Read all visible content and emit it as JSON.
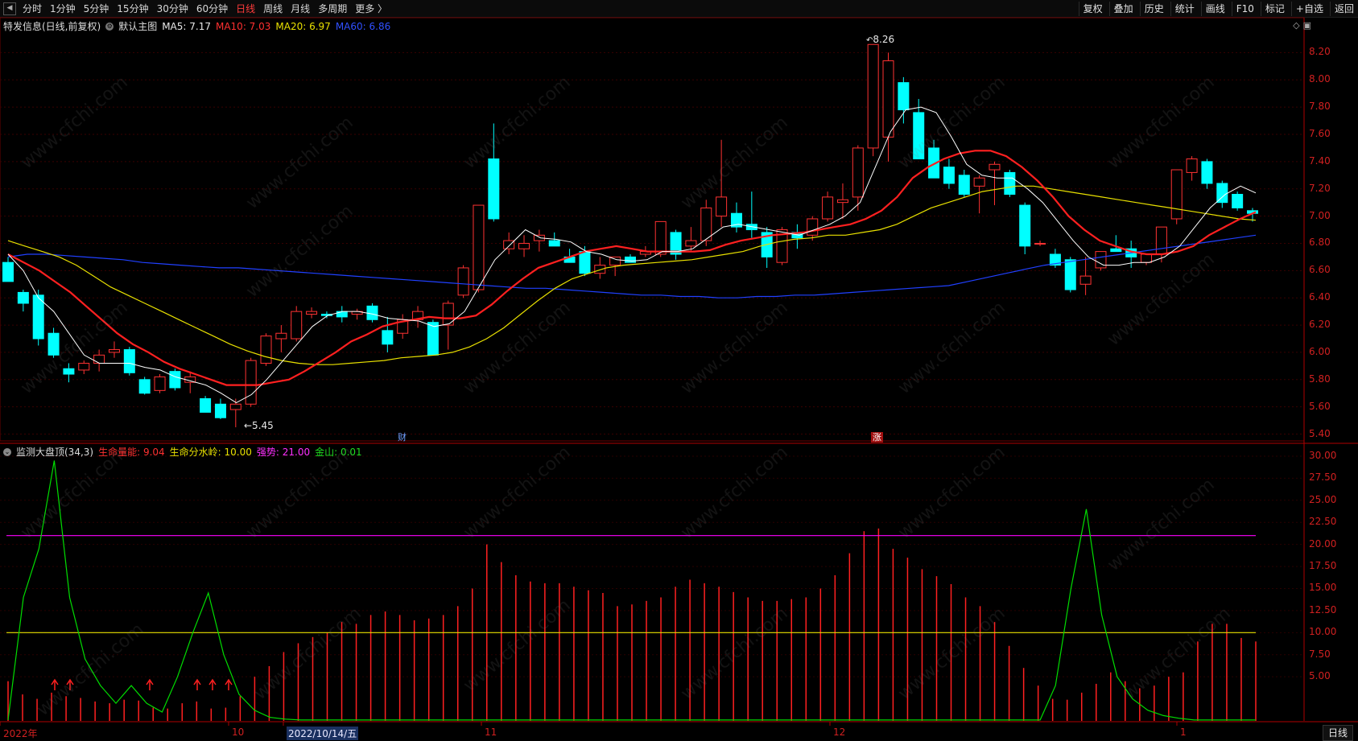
{
  "toolbar": {
    "periods": [
      "分时",
      "1分钟",
      "5分钟",
      "15分钟",
      "30分钟",
      "60分钟",
      "日线",
      "周线",
      "月线",
      "多周期",
      "更多 〉"
    ],
    "active_period": "日线",
    "right_buttons": [
      "复权",
      "叠加",
      "历史",
      "统计",
      "画线",
      "F10",
      "标记",
      "+自选",
      "返回"
    ]
  },
  "main_legend": {
    "stock": "特发信息(日线,前复权)",
    "template": "默认主图",
    "ma5": "MA5: 7.17",
    "ma10": "MA10: 7.03",
    "ma20": "MA20: 6.97",
    "ma60": "MA60: 6.86"
  },
  "sub_legend": {
    "indicator": "监测大盘顶(34,3)",
    "life_energy": "生命量能: 9.04",
    "life_watershed": "生命分水岭: 10.00",
    "strong": "强势: 21.00",
    "gold": "金山: 0.01"
  },
  "price_axis": [
    "8.20",
    "8.00",
    "7.80",
    "7.60",
    "7.40",
    "7.20",
    "7.00",
    "6.80",
    "6.60",
    "6.40",
    "6.20",
    "6.00",
    "5.80",
    "5.60",
    "5.40"
  ],
  "sub_axis": [
    "30.00",
    "27.50",
    "25.00",
    "22.50",
    "20.00",
    "17.50",
    "15.00",
    "12.50",
    "10.00",
    "7.50",
    "5.00"
  ],
  "x_axis": [
    "2022年",
    "10",
    "2022/10/14/五",
    "11",
    "12",
    "1"
  ],
  "annotations": {
    "high": "8.26",
    "low": "←5.45",
    "high_arrow": "↶"
  },
  "markers": {
    "finance": "财",
    "limit_up": "涨"
  },
  "period_button": "日线",
  "watermark": "www.cfchi.com",
  "colors": {
    "up": "#ff3232",
    "down": "#00ffff",
    "ma5": "#ffffff",
    "ma10": "#ff2020",
    "ma20": "#e8e000",
    "ma60": "#2040ff",
    "energy": "#ff2020",
    "green": "#00dd00",
    "magenta": "#ff00ff",
    "yellow": "#e8e000",
    "axis": "#d02020"
  },
  "chart_data": {
    "type": "candlestick",
    "title": "特发信息(日线,前复权)",
    "price_range": [
      5.35,
      8.35
    ],
    "candles": [
      [
        6.66,
        6.7,
        6.52,
        6.52
      ],
      [
        6.44,
        6.46,
        6.3,
        6.36
      ],
      [
        6.42,
        6.46,
        6.05,
        6.1
      ],
      [
        6.14,
        6.18,
        5.96,
        5.98
      ],
      [
        5.88,
        5.92,
        5.78,
        5.84
      ],
      [
        5.87,
        5.94,
        5.84,
        5.92
      ],
      [
        5.92,
        6.02,
        5.86,
        5.98
      ],
      [
        6.0,
        6.08,
        5.96,
        6.02
      ],
      [
        6.02,
        6.04,
        5.83,
        5.85
      ],
      [
        5.8,
        5.82,
        5.69,
        5.7
      ],
      [
        5.72,
        5.84,
        5.7,
        5.82
      ],
      [
        5.86,
        5.88,
        5.72,
        5.74
      ],
      [
        5.78,
        5.86,
        5.7,
        5.82
      ],
      [
        5.66,
        5.68,
        5.56,
        5.56
      ],
      [
        5.62,
        5.66,
        5.51,
        5.52
      ],
      [
        5.58,
        5.66,
        5.45,
        5.62
      ],
      [
        5.62,
        5.96,
        5.6,
        5.94
      ],
      [
        5.92,
        6.14,
        5.9,
        6.12
      ],
      [
        6.1,
        6.2,
        6.0,
        6.14
      ],
      [
        6.1,
        6.34,
        6.08,
        6.3
      ],
      [
        6.28,
        6.33,
        6.25,
        6.3
      ],
      [
        6.28,
        6.3,
        6.25,
        6.27
      ],
      [
        6.3,
        6.34,
        6.22,
        6.26
      ],
      [
        6.28,
        6.32,
        6.24,
        6.3
      ],
      [
        6.34,
        6.36,
        6.22,
        6.24
      ],
      [
        6.16,
        6.26,
        6.0,
        6.06
      ],
      [
        6.14,
        6.28,
        6.1,
        6.24
      ],
      [
        6.24,
        6.34,
        6.18,
        6.3
      ],
      [
        6.22,
        6.24,
        5.98,
        5.98
      ],
      [
        6.2,
        6.38,
        6.02,
        6.36
      ],
      [
        6.42,
        6.64,
        6.4,
        6.62
      ],
      [
        6.46,
        7.08,
        6.44,
        7.08
      ],
      [
        7.42,
        7.68,
        6.96,
        6.98
      ],
      [
        6.76,
        6.88,
        6.72,
        6.82
      ],
      [
        6.76,
        6.86,
        6.7,
        6.8
      ],
      [
        6.82,
        6.9,
        6.74,
        6.86
      ],
      [
        6.82,
        6.88,
        6.78,
        6.78
      ],
      [
        6.7,
        6.76,
        6.68,
        6.66
      ],
      [
        6.74,
        6.78,
        6.56,
        6.58
      ],
      [
        6.58,
        6.7,
        6.54,
        6.64
      ],
      [
        6.64,
        6.7,
        6.56,
        6.7
      ],
      [
        6.7,
        6.72,
        6.66,
        6.66
      ],
      [
        6.72,
        6.78,
        6.7,
        6.74
      ],
      [
        6.72,
        6.96,
        6.7,
        6.96
      ],
      [
        6.88,
        6.9,
        6.68,
        6.72
      ],
      [
        6.78,
        6.92,
        6.74,
        6.82
      ],
      [
        6.82,
        7.12,
        6.78,
        7.06
      ],
      [
        7.0,
        7.56,
        6.92,
        7.14
      ],
      [
        7.02,
        7.1,
        6.88,
        6.92
      ],
      [
        6.94,
        7.18,
        6.84,
        6.9
      ],
      [
        6.88,
        6.92,
        6.62,
        6.7
      ],
      [
        6.66,
        6.92,
        6.64,
        6.9
      ],
      [
        6.88,
        6.94,
        6.76,
        6.84
      ],
      [
        6.86,
        7.0,
        6.82,
        6.98
      ],
      [
        6.98,
        7.18,
        6.96,
        7.14
      ],
      [
        7.1,
        7.24,
        6.98,
        7.12
      ],
      [
        7.14,
        7.52,
        7.04,
        7.5
      ],
      [
        7.5,
        8.26,
        7.44,
        8.26
      ],
      [
        7.58,
        8.2,
        7.4,
        8.14
      ],
      [
        7.98,
        8.02,
        7.68,
        7.78
      ],
      [
        7.76,
        7.86,
        7.42,
        7.42
      ],
      [
        7.5,
        7.56,
        7.28,
        7.28
      ],
      [
        7.36,
        7.42,
        7.2,
        7.24
      ],
      [
        7.3,
        7.34,
        7.14,
        7.16
      ],
      [
        7.22,
        7.3,
        7.02,
        7.28
      ],
      [
        7.34,
        7.4,
        7.08,
        7.38
      ],
      [
        7.32,
        7.34,
        7.14,
        7.16
      ],
      [
        7.08,
        7.1,
        6.72,
        6.78
      ],
      [
        6.8,
        6.82,
        6.78,
        6.8
      ],
      [
        6.72,
        6.76,
        6.62,
        6.64
      ],
      [
        6.68,
        6.7,
        6.44,
        6.46
      ],
      [
        6.5,
        6.7,
        6.42,
        6.56
      ],
      [
        6.62,
        6.72,
        6.6,
        6.74
      ],
      [
        6.76,
        6.86,
        6.74,
        6.74
      ],
      [
        6.76,
        6.82,
        6.62,
        6.7
      ],
      [
        6.66,
        6.7,
        6.64,
        6.72
      ],
      [
        6.72,
        6.8,
        6.66,
        6.92
      ],
      [
        6.98,
        7.34,
        6.94,
        7.34
      ],
      [
        7.32,
        7.44,
        7.26,
        7.42
      ],
      [
        7.4,
        7.42,
        7.2,
        7.24
      ],
      [
        7.24,
        7.26,
        7.06,
        7.1
      ],
      [
        7.16,
        7.18,
        7.04,
        7.06
      ],
      [
        7.04,
        7.06,
        6.96,
        7.02
      ]
    ],
    "ma5": [
      6.72,
      6.6,
      6.4,
      6.3,
      6.14,
      5.98,
      5.92,
      5.92,
      5.92,
      5.89,
      5.87,
      5.82,
      5.79,
      5.76,
      5.7,
      5.63,
      5.69,
      5.8,
      5.93,
      6.06,
      6.19,
      6.27,
      6.3,
      6.3,
      6.28,
      6.25,
      6.24,
      6.23,
      6.19,
      6.21,
      6.3,
      6.49,
      6.68,
      6.79,
      6.9,
      6.84,
      6.83,
      6.81,
      6.74,
      6.72,
      6.68,
      6.67,
      6.68,
      6.74,
      6.74,
      6.76,
      6.84,
      6.92,
      6.94,
      6.92,
      6.9,
      6.88,
      6.86,
      6.9,
      6.94,
      7.0,
      7.1,
      7.36,
      7.62,
      7.78,
      7.8,
      7.76,
      7.58,
      7.38,
      7.3,
      7.28,
      7.28,
      7.2,
      7.1,
      6.96,
      6.82,
      6.7,
      6.64,
      6.64,
      6.66,
      6.66,
      6.7,
      6.78,
      6.92,
      7.06,
      7.16,
      7.22,
      7.17
    ],
    "ma10": [
      6.72,
      6.66,
      6.6,
      6.52,
      6.44,
      6.34,
      6.24,
      6.14,
      6.06,
      6.0,
      5.93,
      5.88,
      5.84,
      5.8,
      5.76,
      5.76,
      5.76,
      5.78,
      5.8,
      5.86,
      5.93,
      6.0,
      6.08,
      6.13,
      6.19,
      6.22,
      6.24,
      6.26,
      6.25,
      6.25,
      6.27,
      6.35,
      6.45,
      6.54,
      6.62,
      6.66,
      6.7,
      6.74,
      6.76,
      6.78,
      6.76,
      6.74,
      6.74,
      6.74,
      6.74,
      6.75,
      6.79,
      6.82,
      6.84,
      6.86,
      6.87,
      6.88,
      6.9,
      6.92,
      6.94,
      6.98,
      7.04,
      7.14,
      7.28,
      7.36,
      7.42,
      7.46,
      7.48,
      7.48,
      7.44,
      7.36,
      7.26,
      7.14,
      7.0,
      6.9,
      6.82,
      6.78,
      6.74,
      6.72,
      6.72,
      6.74,
      6.78,
      6.86,
      6.92,
      6.98,
      7.03
    ],
    "ma20": [
      6.82,
      6.78,
      6.74,
      6.7,
      6.64,
      6.56,
      6.48,
      6.42,
      6.36,
      6.3,
      6.24,
      6.18,
      6.12,
      6.06,
      6.01,
      5.97,
      5.94,
      5.92,
      5.91,
      5.91,
      5.92,
      5.93,
      5.94,
      5.96,
      5.97,
      5.98,
      6.0,
      6.04,
      6.1,
      6.18,
      6.28,
      6.38,
      6.47,
      6.54,
      6.58,
      6.62,
      6.64,
      6.65,
      6.66,
      6.67,
      6.68,
      6.7,
      6.72,
      6.74,
      6.78,
      6.81,
      6.83,
      6.84,
      6.86,
      6.86,
      6.88,
      6.9,
      6.94,
      7.0,
      7.06,
      7.1,
      7.14,
      7.18,
      7.2,
      7.22,
      7.22,
      7.2,
      7.18,
      7.16,
      7.14,
      7.12,
      7.1,
      7.08,
      7.06,
      7.04,
      7.02,
      7.0,
      6.98,
      6.97
    ],
    "ma60": [
      6.7,
      6.72,
      6.72,
      6.71,
      6.7,
      6.69,
      6.68,
      6.66,
      6.65,
      6.64,
      6.63,
      6.62,
      6.62,
      6.61,
      6.6,
      6.59,
      6.58,
      6.57,
      6.56,
      6.55,
      6.54,
      6.53,
      6.52,
      6.51,
      6.5,
      6.49,
      6.48,
      6.47,
      6.47,
      6.46,
      6.45,
      6.44,
      6.43,
      6.42,
      6.42,
      6.41,
      6.41,
      6.4,
      6.4,
      6.41,
      6.41,
      6.42,
      6.42,
      6.43,
      6.44,
      6.45,
      6.46,
      6.47,
      6.48,
      6.49,
      6.52,
      6.55,
      6.58,
      6.61,
      6.64,
      6.66,
      6.68,
      6.7,
      6.72,
      6.74,
      6.76,
      6.78,
      6.8,
      6.82,
      6.84,
      6.86
    ],
    "energy": [
      4.5,
      3.0,
      2.5,
      3.2,
      2.8,
      2.6,
      2.2,
      2.0,
      2.4,
      2.3,
      1.5,
      1.4,
      2.0,
      2.2,
      1.4,
      1.5,
      2.8,
      5.0,
      6.2,
      7.8,
      8.8,
      9.5,
      10.0,
      11.2,
      11.0,
      12.0,
      12.4,
      12.0,
      11.4,
      11.6,
      12.0,
      13.0,
      15.0,
      20.0,
      18.0,
      16.5,
      15.8,
      15.6,
      15.6,
      15.2,
      14.8,
      14.5,
      13.0,
      13.2,
      13.6,
      14.0,
      15.2,
      16.0,
      15.6,
      15.2,
      14.6,
      14.0,
      13.6,
      13.6,
      13.8,
      14.0,
      15.0,
      16.5,
      19.0,
      21.5,
      21.8,
      19.5,
      18.5,
      17.2,
      16.4,
      15.5,
      14.0,
      13.0,
      11.2,
      8.5,
      6.0,
      4.0,
      2.5,
      2.4,
      3.2,
      4.2,
      5.5,
      4.5,
      3.7,
      4.0,
      5.0,
      5.5,
      9.0,
      11.0,
      11.0,
      9.4,
      9.0
    ],
    "gold_line": [
      0.1,
      14.0,
      19.5,
      29.5,
      14.0,
      7.0,
      4.0,
      2.0,
      4.0,
      2.0,
      1.0,
      5.0,
      10.0,
      14.5,
      7.5,
      3.0,
      1.2,
      0.4,
      0.2,
      0.1,
      0.1,
      0.1,
      0.1,
      0.1,
      0.1,
      0.1,
      0.1,
      0.1,
      0.1,
      0.1,
      0.1,
      0.1,
      0.1,
      0.1,
      0.1,
      0.1,
      0.1,
      0.1,
      0.1,
      0.1,
      0.1,
      0.1,
      0.1,
      0.1,
      0.1,
      0.1,
      0.1,
      0.1,
      0.1,
      0.1,
      0.1,
      0.1,
      0.1,
      0.1,
      0.1,
      0.1,
      0.1,
      0.1,
      0.1,
      0.1,
      0.1,
      0.1,
      0.1,
      0.1,
      0.1,
      0.1,
      0.1,
      0.1,
      4.0,
      15.0,
      24.0,
      12.0,
      5.0,
      2.5,
      1.2,
      0.6,
      0.3,
      0.1,
      0.1,
      0.1,
      0.1,
      0.1
    ],
    "strong_level": 21.0,
    "watershed_level": 10.0,
    "sub_range": [
      0,
      31
    ],
    "signals_count": 6
  }
}
